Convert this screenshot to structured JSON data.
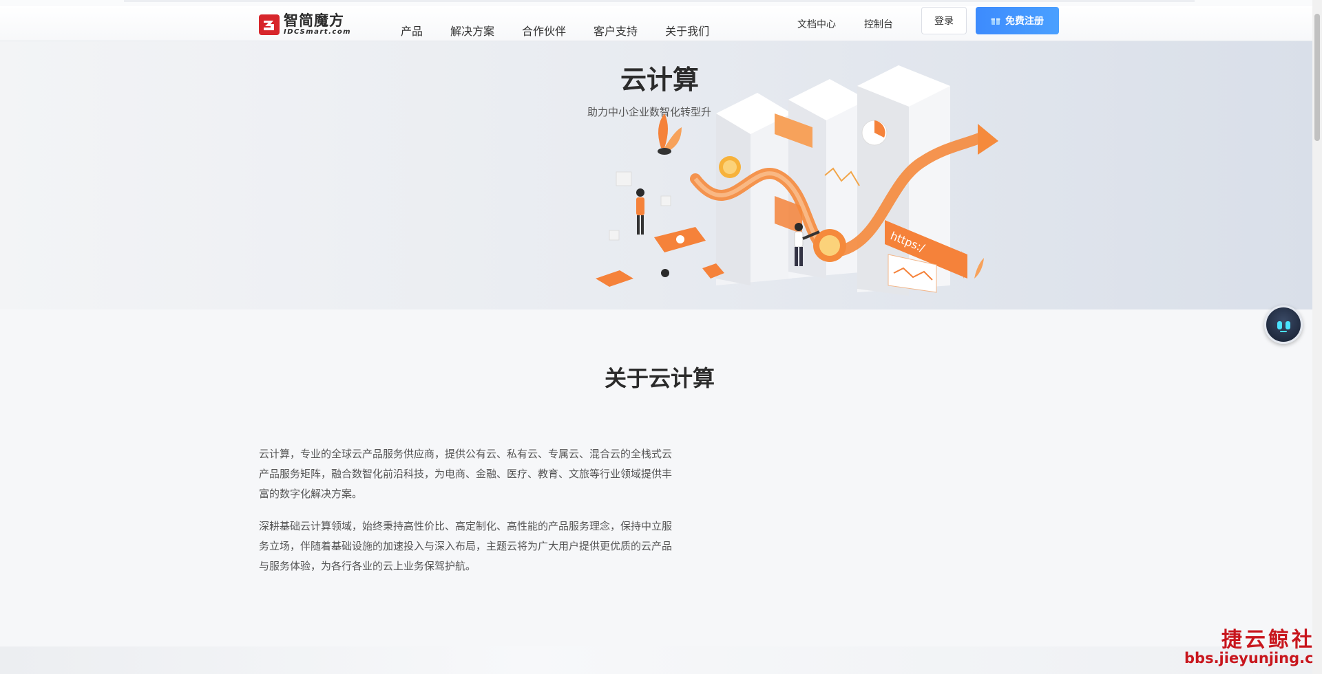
{
  "header": {
    "logo": {
      "cn": "智简魔方",
      "en": "IDCSmart.com"
    },
    "nav": [
      "产品",
      "解决方案",
      "合作伙伴",
      "客户支持",
      "关于我们"
    ],
    "links": {
      "docs": "文档中心",
      "console": "控制台"
    },
    "login_label": "登录",
    "register_label": "免费注册"
  },
  "hero": {
    "title": "云计算",
    "subtitle": "助力中小企业数智化转型升",
    "illustration_label": "https:/"
  },
  "about": {
    "title": "关于云计算",
    "paragraphs": [
      "云计算，专业的全球云产品服务供应商，提供公有云、私有云、专属云、混合云的全栈式云产品服务矩阵，融合数智化前沿科技，为电商、金融、医疗、教育、文旅等行业领域提供丰富的数字化解决方案。",
      "深耕基础云计算领域，始终秉持高性价比、高定制化、高性能的产品服务理念，保持中立服务立场，伴随着基础设施的加速投入与深入布局，主题云将为广大用户提供更优质的云产品与服务体验，为各行各业的云上业务保驾护航。"
    ]
  },
  "watermark": {
    "cn": "捷云鲸社区",
    "en": "bbs.jieyunjing.com"
  },
  "colors": {
    "accent": "#3d8bfd",
    "brand_red": "#d7262b",
    "illustration_orange": "#f5823a"
  },
  "icons": [
    "logo-icon",
    "gift-icon",
    "robot-assistant-icon"
  ]
}
